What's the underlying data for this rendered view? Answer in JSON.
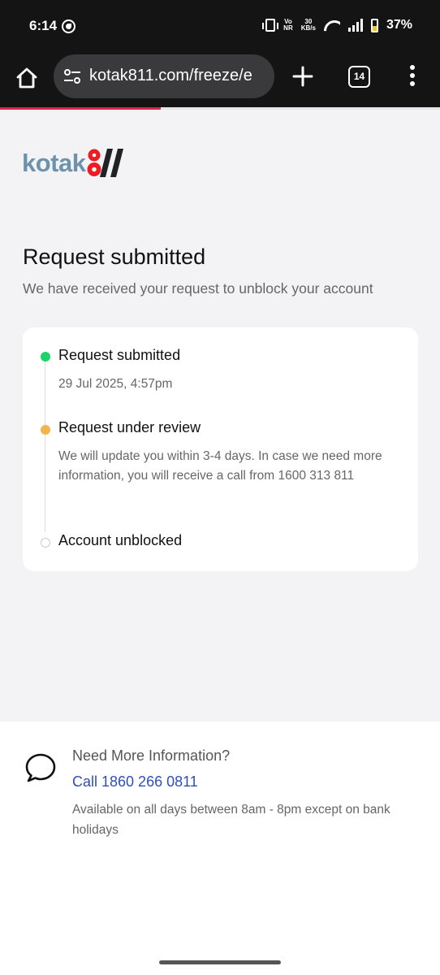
{
  "status_bar": {
    "time": "6:14",
    "network_top": "Vo",
    "network_bottom": "NR",
    "speed_top": "30",
    "speed_bottom": "KB/s",
    "battery": "37%"
  },
  "browser": {
    "url": "kotak811.com/freeze/e",
    "tab_count": "14",
    "load_progress": 0.365
  },
  "brand": {
    "wordmark": "kotak",
    "accent": "#ed1c24",
    "word_color": "#6c93ab",
    "stripe_color": "#222222"
  },
  "page": {
    "title": "Request submitted",
    "subtitle": "We have received your request to unblock your account"
  },
  "timeline": [
    {
      "title": "Request submitted",
      "detail": "29 Jul 2025, 4:57pm",
      "state": "done",
      "color": "#1ed467"
    },
    {
      "title": "Request under review",
      "detail": "We will update you within 3-4 days. In case we need more information, you will receive a call from 1600 313 811",
      "state": "in-progress",
      "color": "#f3b44b"
    },
    {
      "title": "Account unblocked",
      "detail": "",
      "state": "pending"
    }
  ],
  "help": {
    "title": "Need More Information?",
    "call_label": "Call 1860 266 0811",
    "note": "Available on all days between 8am - 8pm except on bank holidays"
  }
}
